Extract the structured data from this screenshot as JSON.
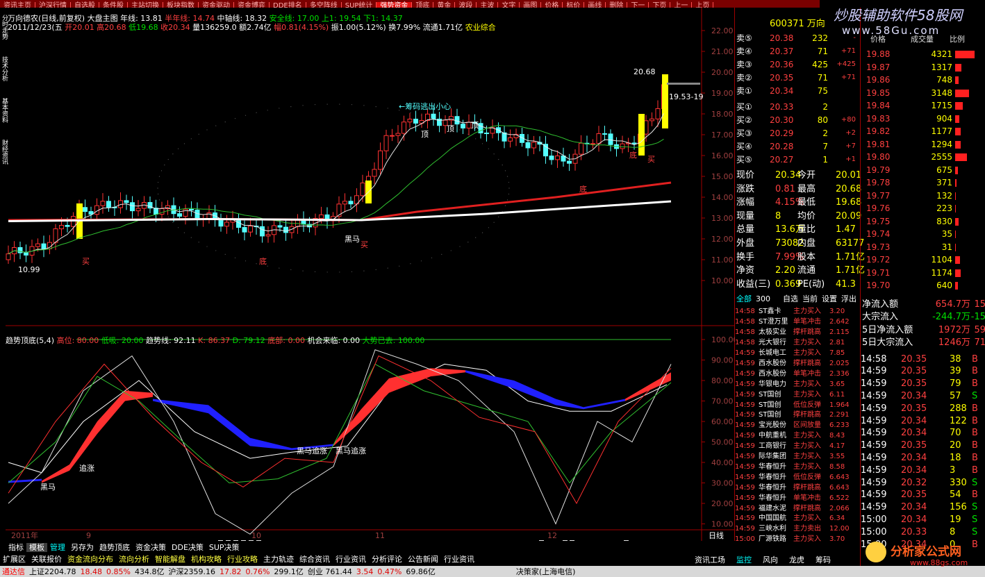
{
  "top_menu": [
    "资讯主页",
    "沪深行情",
    "自选股",
    "条件股",
    "主站切换",
    "板块指数",
    "资金驱动",
    "资金博弈",
    "DDE排名",
    "多空阵线",
    "SUP统计",
    "强势资金",
    "顶底",
    "黄金",
    "波段",
    "主波",
    "文字",
    "画图",
    "价格",
    "标价",
    "画线",
    "删除",
    "下一",
    "下页",
    "上一",
    "上页"
  ],
  "left_strip": [
    "分时走势",
    "技术分析",
    "基本资料",
    "财经资讯"
  ],
  "info_line1": [
    {
      "t": "万向德农(日线,前复权) 大盘主图 年线: 13.81",
      "c": "#fff"
    },
    {
      "t": " 半年线: 14.74",
      "c": "#ff4040"
    },
    {
      "t": "  中轴线: 18.32",
      "c": "#fff"
    },
    {
      "t": " 安全线: 17.00",
      "c": "#00e000"
    },
    {
      "t": "  上1: 19.54",
      "c": "#00e000"
    },
    {
      "t": "  下1: 14.37",
      "c": "#00e000"
    }
  ],
  "info_line2": [
    {
      "t": "2011/12/23(五",
      "c": "#fff"
    },
    {
      "t": " 开20.01 高20.68",
      "c": "#ff4040"
    },
    {
      "t": " 低19.68",
      "c": "#00e000"
    },
    {
      "t": " 收20.34",
      "c": "#ff4040"
    },
    {
      "t": " 量136259.0 额2.74亿",
      "c": "#fff"
    },
    {
      "t": " 幅0.81(4.15%)",
      "c": "#ff4040"
    },
    {
      "t": " 振1.00(5.12%) 换7.99% 流通1.71亿",
      "c": "#fff"
    },
    {
      "t": " 农业综合",
      "c": "#ffff00"
    }
  ],
  "price_axis": [
    "22.00",
    "21.00",
    "20.00",
    "19.00",
    "18.00",
    "17.00",
    "16.00",
    "15.00",
    "14.00",
    "13.00",
    "12.00",
    "11.00",
    "10.00"
  ],
  "ind_axis": [
    "100.00",
    "90.00",
    "80.00",
    "70.00",
    "60.00",
    "50.00",
    "40.00",
    "30.00",
    "20.00",
    "10.00"
  ],
  "chart_labels": {
    "high": "20.68",
    "low": "10.99",
    "mark1": "19.53-19",
    "chip_warn": "←筹码逃出小心",
    "top1": "顶",
    "top2": "顶",
    "top3": "顶",
    "buy1": "买",
    "buy2": "买",
    "buy3": "买",
    "bottom1": "底",
    "bottom2": "底",
    "bottom3": "底",
    "dark_horse": "黑马"
  },
  "ind_header": [
    {
      "t": "趋势顶底(5,4)",
      "c": "#fff"
    },
    {
      "t": "    高位: 80.00",
      "c": "#ff4040"
    },
    {
      "t": "  低吸: 20.00",
      "c": "#00e000"
    },
    {
      "t": "    趋势线: 92.11",
      "c": "#fff"
    },
    {
      "t": "  K: 86.37",
      "c": "#ff4040"
    },
    {
      "t": "  D: 79.12",
      "c": "#00e000"
    },
    {
      "t": "       底部: 0.00",
      "c": "#ff4040"
    },
    {
      "t": "  机会来临: 0.00",
      "c": "#fff"
    },
    {
      "t": "  大势已去: 100.00",
      "c": "#00e000"
    }
  ],
  "ind_labels": {
    "chase1": "追涨",
    "horse": "黑马",
    "jump1": "黑马追涨",
    "jump2": "黑马追涨"
  },
  "x_dates": [
    "2011年",
    "9",
    "10",
    "11",
    "12"
  ],
  "bottom_tabs": [
    "指标",
    "模板",
    "管理",
    "另存为",
    "趋势顶底",
    "资金决策",
    "DDE决策",
    "SUP决策"
  ],
  "period": "日线",
  "func_bar": [
    "扩展区",
    "关联报价",
    "资金流向分布",
    "流向分析",
    "智能解盘",
    "机构攻略",
    "行业攻略",
    "主力轨迹",
    "综合资讯",
    "行业资讯",
    "分析评论",
    "公告新闻",
    "行业资讯"
  ],
  "status_bar": {
    "app": "通达信",
    "sh": "上证2204.78",
    "sh_chg": "18.48",
    "sh_pct": "0.85%",
    "sh_amt": "434.8亿",
    "sz": "沪深2359.16",
    "sz_chg": "17.82",
    "sz_pct": "0.76%",
    "sz_amt": "299.1亿",
    "cy": "创业 761.44",
    "cy_chg": "3.54",
    "cy_pct": "0.47%",
    "cy_amt": "69.86亿",
    "server": "决策家(上海电信)"
  },
  "right_panel": {
    "code": "600371 万向",
    "asks": [
      {
        "l": "卖⑤",
        "p": "20.38",
        "v": "232",
        "c": "-"
      },
      {
        "l": "卖④",
        "p": "20.37",
        "v": "71",
        "c": "+71"
      },
      {
        "l": "卖③",
        "p": "20.36",
        "v": "425",
        "c": "+425"
      },
      {
        "l": "卖②",
        "p": "20.35",
        "v": "71",
        "c": "+71"
      },
      {
        "l": "卖①",
        "p": "20.34",
        "v": "75",
        "c": ""
      }
    ],
    "bids": [
      {
        "l": "买①",
        "p": "20.33",
        "v": "2",
        "c": ""
      },
      {
        "l": "买②",
        "p": "20.30",
        "v": "80",
        "c": "+80"
      },
      {
        "l": "买③",
        "p": "20.29",
        "v": "2",
        "c": "+2"
      },
      {
        "l": "买④",
        "p": "20.28",
        "v": "7",
        "c": "+7"
      },
      {
        "l": "买⑤",
        "p": "20.27",
        "v": "1",
        "c": "+1"
      }
    ],
    "stats": [
      [
        "现价",
        "20.34",
        "今开",
        "20.01"
      ],
      [
        "涨跌",
        "0.81",
        "最高",
        "20.68"
      ],
      [
        "涨幅",
        "4.15%",
        "最低",
        "19.68"
      ],
      [
        "现量",
        "8",
        "均价",
        "20.09"
      ],
      [
        "总量",
        "13.6万",
        "量比",
        "1.47"
      ],
      [
        "外盘",
        "73082",
        "内盘",
        "63177"
      ],
      [
        "换手",
        "7.99%",
        "股本",
        "1.71亿"
      ],
      [
        "净资",
        "2.20",
        "流通",
        "1.71亿"
      ],
      [
        "收益(三)",
        "0.369",
        "PE(动)",
        "41.3"
      ]
    ],
    "tabs": [
      "全部",
      "300",
      "自选",
      "当前",
      "设置",
      "浮出"
    ],
    "news": [
      [
        "14:58",
        "ST鑫卡",
        "主力买入",
        "3.20"
      ],
      [
        "14:58",
        "ST澄万里",
        "单笔冲击",
        "2.642"
      ],
      [
        "14:58",
        "太极实业",
        "撑杆跳高",
        "2.115"
      ],
      [
        "14:58",
        "光大银行",
        "主力买入",
        "2.81"
      ],
      [
        "14:59",
        "长城电工",
        "主力买入",
        "7.85"
      ],
      [
        "14:59",
        "西水股份",
        "撑杆跳高",
        "2.025"
      ],
      [
        "14:59",
        "西水股份",
        "单笔冲击",
        "2.336"
      ],
      [
        "14:59",
        "华银电力",
        "主力买入",
        "3.65"
      ],
      [
        "14:59",
        "ST国创",
        "主力买入",
        "6.11"
      ],
      [
        "14:59",
        "ST国创",
        "低位反弹",
        "1.964"
      ],
      [
        "14:59",
        "ST国创",
        "撑杆跳高",
        "2.291"
      ],
      [
        "14:59",
        "宝光股份",
        "区间放量",
        "6.233"
      ],
      [
        "14:59",
        "中航重机",
        "主力买入",
        "8.43"
      ],
      [
        "14:59",
        "工商银行",
        "主力买入",
        "4.17"
      ],
      [
        "14:59",
        "际华集团",
        "主力买入",
        "3.55"
      ],
      [
        "14:59",
        "华春恒升",
        "主力买入",
        "8.58"
      ],
      [
        "14:59",
        "华春恒升",
        "低位反弹",
        "6.643"
      ],
      [
        "14:59",
        "华春恒升",
        "撑杆跳高",
        "6.643"
      ],
      [
        "14:59",
        "华春恒升",
        "单笔冲击",
        "6.522"
      ],
      [
        "14:59",
        "福建水泥",
        "撑杆跳高",
        "2.066"
      ],
      [
        "14:59",
        "中国国航",
        "主力买入",
        "6.34"
      ],
      [
        "14:59",
        "三峡水利",
        "主力卖出",
        "12.00"
      ],
      [
        "15:00",
        "厂源铁路",
        "主力买入",
        "3.70"
      ]
    ],
    "bottom_tabs": [
      "资讯工场",
      "监控",
      "风向",
      "龙虎",
      "筹码"
    ]
  },
  "tick_list": {
    "header": [
      "价格",
      "成交量",
      "比例"
    ],
    "depth": [
      [
        "19.88",
        "4321"
      ],
      [
        "19.87",
        "1317"
      ],
      [
        "19.86",
        "748"
      ],
      [
        "19.85",
        "3148"
      ],
      [
        "19.84",
        "1715"
      ],
      [
        "19.83",
        "904"
      ],
      [
        "19.82",
        "1177"
      ],
      [
        "19.81",
        "1294"
      ],
      [
        "19.80",
        "2555"
      ],
      [
        "19.79",
        "675"
      ],
      [
        "19.78",
        "371"
      ],
      [
        "19.77",
        "132"
      ],
      [
        "19.76",
        "223"
      ],
      [
        "19.75",
        "830"
      ],
      [
        "19.74",
        "35"
      ],
      [
        "19.73",
        "31"
      ],
      [
        "19.72",
        "1104"
      ],
      [
        "19.71",
        "1174"
      ],
      [
        "19.70",
        "640"
      ]
    ],
    "flows": [
      [
        "净流入额",
        "654.7万",
        "15"
      ],
      [
        "大宗流入",
        "-244.7万",
        "-15"
      ],
      [
        "5日净流入额",
        "1972万",
        "59"
      ],
      [
        "5日大宗流入",
        "1246万",
        "71"
      ]
    ],
    "ticks": [
      [
        "14:58",
        "20.35",
        "38",
        "B"
      ],
      [
        "14:59",
        "20.35",
        "39",
        "B"
      ],
      [
        "14:59",
        "20.35",
        "79",
        "B"
      ],
      [
        "14:59",
        "20.34",
        "57",
        "S"
      ],
      [
        "14:59",
        "20.35",
        "288",
        "B"
      ],
      [
        "14:59",
        "20.34",
        "122",
        "B"
      ],
      [
        "14:59",
        "20.34",
        "70",
        "B"
      ],
      [
        "14:59",
        "20.35",
        "20",
        "B"
      ],
      [
        "14:59",
        "20.34",
        "18",
        "B"
      ],
      [
        "14:59",
        "20.34",
        "3",
        "B"
      ],
      [
        "14:59",
        "20.32",
        "330",
        "S"
      ],
      [
        "14:59",
        "20.35",
        "54",
        "B"
      ],
      [
        "14:59",
        "20.34",
        "156",
        "S"
      ],
      [
        "15:00",
        "20.34",
        "19",
        "S"
      ],
      [
        "15:00",
        "20.33",
        "8",
        "S"
      ],
      [
        "15:00",
        "20.34",
        "0",
        "B"
      ]
    ]
  },
  "watermark": "炒股辅助软件58股网",
  "watermark_url": "www.58Gu.com",
  "logo": "分析家公式网",
  "logo_url": "www.88gs.com"
}
